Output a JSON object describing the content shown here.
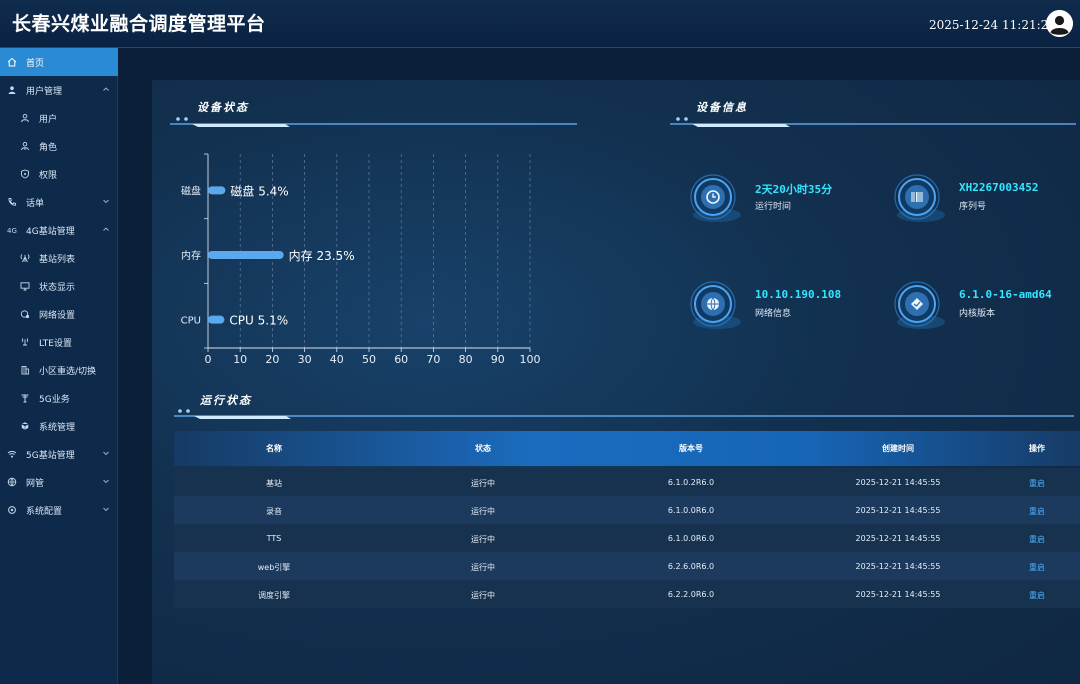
{
  "header": {
    "title": "长春兴煤业融合调度管理平台",
    "datetime": "2025-12-24 11:21:21"
  },
  "sidebar": {
    "items": [
      {
        "label": "首页",
        "icon": "home-icon",
        "active": true
      },
      {
        "label": "用户管理",
        "icon": "user-group-icon",
        "expanded": true
      },
      {
        "label": "用户",
        "icon": "user-icon",
        "sub": true
      },
      {
        "label": "角色",
        "icon": "role-icon",
        "sub": true
      },
      {
        "label": "权限",
        "icon": "shield-icon",
        "sub": true
      },
      {
        "label": "话单",
        "icon": "phone-icon",
        "expanded": false
      },
      {
        "label": "4G基站管理",
        "icon": "signal-4g-icon",
        "expanded": true
      },
      {
        "label": "基站列表",
        "icon": "antenna-icon",
        "sub": true
      },
      {
        "label": "状态显示",
        "icon": "monitor-icon",
        "sub": true
      },
      {
        "label": "网络设置",
        "icon": "network-icon",
        "sub": true
      },
      {
        "label": "LTE设置",
        "icon": "lte-icon",
        "sub": true
      },
      {
        "label": "小区重选/切换",
        "icon": "building-icon",
        "sub": true
      },
      {
        "label": "5G业务",
        "icon": "tower-icon",
        "sub": true
      },
      {
        "label": "系统管理",
        "icon": "cube-icon",
        "sub": true
      },
      {
        "label": "5G基站管理",
        "icon": "wifi-icon",
        "expanded": false
      },
      {
        "label": "网管",
        "icon": "globe-icon",
        "expanded": false
      },
      {
        "label": "系统配置",
        "icon": "settings-icon",
        "expanded": false
      }
    ]
  },
  "sections": {
    "device_status": "设备状态",
    "device_info": "设备信息",
    "run_status": "运行状态"
  },
  "chart_data": {
    "type": "bar",
    "orientation": "horizontal",
    "categories": [
      "磁盘",
      "内存",
      "CPU"
    ],
    "values": [
      5.4,
      23.5,
      5.1
    ],
    "data_labels": [
      "磁盘 5.4%",
      "内存 23.5%",
      "CPU 5.1%"
    ],
    "x_ticks": [
      0,
      10,
      20,
      30,
      40,
      50,
      60,
      70,
      80,
      90,
      100
    ],
    "xlim": [
      0,
      100
    ],
    "grid": true,
    "bar_color": "#5aa9ef"
  },
  "device_info": [
    {
      "value": "2天20小时35分",
      "label": "运行时间",
      "icon": "clock-icon"
    },
    {
      "value": "XH2267003452",
      "label": "序列号",
      "icon": "barcode-icon"
    },
    {
      "value": "10.10.190.108",
      "label": "网络信息",
      "icon": "globe-icon"
    },
    {
      "value": "6.1.0-16-amd64",
      "label": "内核版本",
      "icon": "kernel-icon"
    }
  ],
  "table": {
    "headers": [
      "名称",
      "状态",
      "版本号",
      "创建时间",
      "操作"
    ],
    "rows": [
      [
        "基站",
        "运行中",
        "6.1.0.2R6.0",
        "2025-12-21 14:45:55",
        "重启"
      ],
      [
        "录音",
        "运行中",
        "6.1.0.0R6.0",
        "2025-12-21 14:45:55",
        "重启"
      ],
      [
        "TTS",
        "运行中",
        "6.1.0.0R6.0",
        "2025-12-21 14:45:55",
        "重启"
      ],
      [
        "web引擎",
        "运行中",
        "6.2.6.0R6.0",
        "2025-12-21 14:45:55",
        "重启"
      ],
      [
        "调度引擎",
        "运行中",
        "6.2.2.0R6.0",
        "2025-12-21 14:45:55",
        "重启"
      ]
    ]
  }
}
